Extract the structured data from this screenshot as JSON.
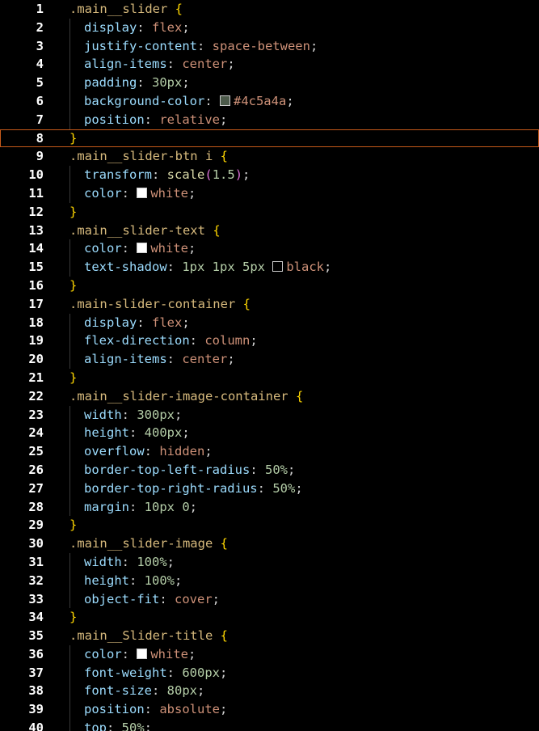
{
  "lines": [
    {
      "n": "1",
      "sel": ".main__slider",
      "brace": " {"
    },
    {
      "n": "2",
      "prop": "display",
      "val": "flex"
    },
    {
      "n": "3",
      "prop": "justify-content",
      "val": "space-between"
    },
    {
      "n": "4",
      "prop": "align-items",
      "val": "center"
    },
    {
      "n": "5",
      "prop": "padding",
      "num": "30px"
    },
    {
      "n": "6",
      "prop": "background-color",
      "swatch": "#4c5a4a",
      "val": "#4c5a4a"
    },
    {
      "n": "7",
      "prop": "position",
      "val": "relative"
    },
    {
      "n": "8",
      "close": "}"
    },
    {
      "n": "9",
      "sel": ".main__slider-btn i",
      "brace": " {"
    },
    {
      "n": "10",
      "prop": "transform",
      "fn": "scale",
      "arg": "1.5"
    },
    {
      "n": "11",
      "prop": "color",
      "swatch": "#ffffff",
      "val": "white"
    },
    {
      "n": "12",
      "close": "}"
    },
    {
      "n": "13",
      "sel": ".main__slider-text",
      "brace": " {"
    },
    {
      "n": "14",
      "prop": "color",
      "swatch": "#ffffff",
      "val": "white"
    },
    {
      "n": "15",
      "prop": "text-shadow",
      "num": "1px 1px 5px",
      "swatch": "#000000",
      "val": "black"
    },
    {
      "n": "16",
      "close": "}"
    },
    {
      "n": "17",
      "sel": ".main-slider-container",
      "brace": " {"
    },
    {
      "n": "18",
      "prop": "display",
      "val": "flex"
    },
    {
      "n": "19",
      "prop": "flex-direction",
      "val": "column"
    },
    {
      "n": "20",
      "prop": "align-items",
      "val": "center"
    },
    {
      "n": "21",
      "close": "}"
    },
    {
      "n": "22",
      "sel": ".main__slider-image-container",
      "brace": " {"
    },
    {
      "n": "23",
      "prop": "width",
      "num": "300px"
    },
    {
      "n": "24",
      "prop": "height",
      "num": "400px"
    },
    {
      "n": "25",
      "prop": "overflow",
      "val": "hidden"
    },
    {
      "n": "26",
      "prop": "border-top-left-radius",
      "num": "50%"
    },
    {
      "n": "27",
      "prop": "border-top-right-radius",
      "num": "50%"
    },
    {
      "n": "28",
      "prop": "margin",
      "num": "10px 0"
    },
    {
      "n": "29",
      "close": "}"
    },
    {
      "n": "30",
      "sel": ".main__slider-image",
      "brace": " {"
    },
    {
      "n": "31",
      "prop": "width",
      "num": "100%"
    },
    {
      "n": "32",
      "prop": "height",
      "num": "100%"
    },
    {
      "n": "33",
      "prop": "object-fit",
      "val": "cover"
    },
    {
      "n": "34",
      "close": "}"
    },
    {
      "n": "35",
      "sel": ".main__Slider-title",
      "brace": " {"
    },
    {
      "n": "36",
      "prop": "color",
      "swatch": "#ffffff",
      "val": "white"
    },
    {
      "n": "37",
      "prop": "font-weight",
      "num": "600px"
    },
    {
      "n": "38",
      "prop": "font-size",
      "num": "80px"
    },
    {
      "n": "39",
      "prop": "position",
      "val": "absolute"
    },
    {
      "n": "40",
      "prop": "top",
      "num": "50%"
    }
  ],
  "current_line": "8",
  "colors": {
    "background": "#000000",
    "selector": "#d7ba7d",
    "property": "#9cdcfe",
    "value": "#ce9178",
    "number": "#b5cea8",
    "current_line_border": "#c55a1a"
  }
}
